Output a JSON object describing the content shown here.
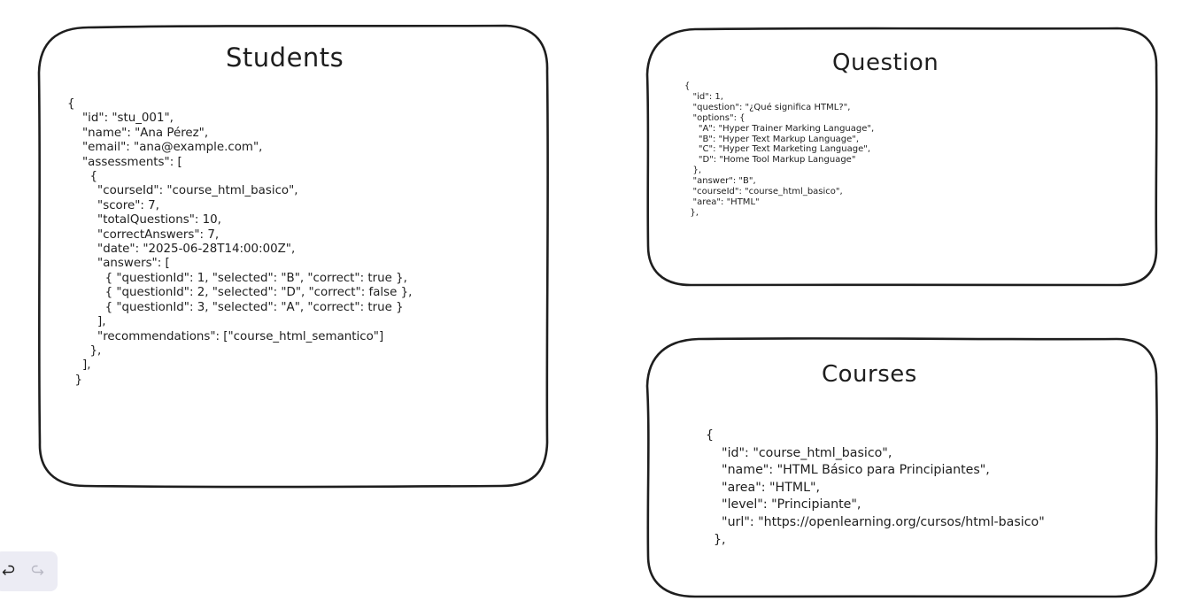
{
  "diagram": {
    "students": {
      "title": "Students",
      "json": "{\n    \"id\": \"stu_001\",\n    \"name\": \"Ana Pérez\",\n    \"email\": \"ana@example.com\",\n    \"assessments\": [\n      {\n        \"courseId\": \"course_html_basico\",\n        \"score\": 7,\n        \"totalQuestions\": 10,\n        \"correctAnswers\": 7,\n        \"date\": \"2025-06-28T14:00:00Z\",\n        \"answers\": [\n          { \"questionId\": 1, \"selected\": \"B\", \"correct\": true },\n          { \"questionId\": 2, \"selected\": \"D\", \"correct\": false },\n          { \"questionId\": 3, \"selected\": \"A\", \"correct\": true }\n        ],\n        \"recommendations\": [\"course_html_semantico\"]\n      },\n    ],\n  }"
    },
    "question": {
      "title": "Question",
      "json": "{\n   \"id\": 1,\n   \"question\": \"¿Qué significa HTML?\",\n   \"options\": {\n     \"A\": \"Hyper Trainer Marking Language\",\n     \"B\": \"Hyper Text Markup Language\",\n     \"C\": \"Hyper Text Marketing Language\",\n     \"D\": \"Home Tool Markup Language\"\n   },\n   \"answer\": \"B\",\n   \"courseId\": \"course_html_basico\",\n   \"area\": \"HTML\"\n  },"
    },
    "courses": {
      "title": "Courses",
      "json": "{\n    \"id\": \"course_html_basico\",\n    \"name\": \"HTML Básico para Principiantes\",\n    \"area\": \"HTML\",\n    \"level\": \"Principiante\",\n    \"url\": \"https://openlearning.org/cursos/html-basico\"\n  },"
    }
  },
  "toolbar": {
    "undo_icon": "undo-icon",
    "redo_icon": "redo-icon"
  },
  "colors": {
    "stroke": "#1e1e1e",
    "canvas": "#ffffff",
    "toolbar_bg": "#ececf4",
    "disabled_icon": "#b8b8c4"
  }
}
